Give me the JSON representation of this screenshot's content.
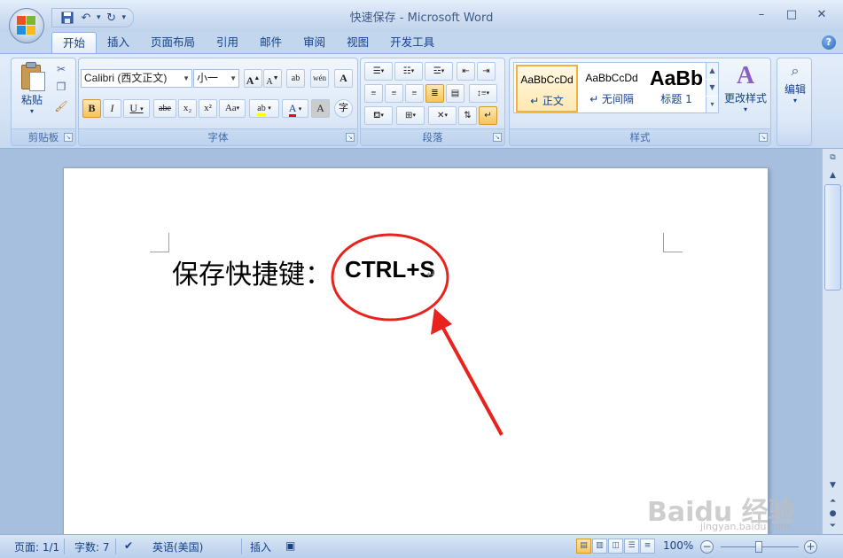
{
  "window": {
    "title": "快速保存 - Microsoft Word",
    "controls": {
      "minimize": "–",
      "maximize": "□",
      "close": "✕"
    }
  },
  "qat": {
    "save_icon": "save-icon",
    "undo_icon": "undo-icon",
    "redo_icon": "redo-icon",
    "customize": "▾"
  },
  "tabs": [
    "开始",
    "插入",
    "页面布局",
    "引用",
    "邮件",
    "审阅",
    "视图",
    "开发工具"
  ],
  "active_tab": "开始",
  "ribbon": {
    "clipboard": {
      "label": "剪贴板",
      "paste_label": "粘贴"
    },
    "font": {
      "label": "字体",
      "font_name": "Calibri (西文正文)",
      "font_size": "小一",
      "grow": "A",
      "shrink": "A",
      "clear": "ab",
      "phonetic": "wén",
      "border_char": "A",
      "bold": "B",
      "italic": "I",
      "underline": "U",
      "strike": "abe",
      "subscript": "x₂",
      "superscript": "x²",
      "case": "Aa",
      "highlight": "ab",
      "font_color": "A",
      "shading": "A",
      "enclose": "字"
    },
    "paragraph": {
      "label": "段落"
    },
    "styles": {
      "label": "样式",
      "items": [
        {
          "sample": "AaBbCcDd",
          "name": "↵ 正文"
        },
        {
          "sample": "AaBbCcDd",
          "name": "↵ 无间隔"
        },
        {
          "sample": "AaBb",
          "name": "标题 1"
        }
      ],
      "change_styles": "更改样式"
    },
    "editing": {
      "label": "编辑"
    }
  },
  "document": {
    "text": "保存快捷键：",
    "shortcut": "CTRL+S",
    "paragraph_mark": "↵"
  },
  "status": {
    "page": "页面: 1/1",
    "words": "字数: 7",
    "language": "英语(美国)",
    "mode": "插入",
    "zoom": "100%"
  },
  "watermark": {
    "main": "Baidu 经验",
    "sub": "jingyan.baidu.com"
  },
  "colors": {
    "annotation": "#e8231d",
    "highlight": "#ffff00",
    "font_color": "#ff0000"
  }
}
